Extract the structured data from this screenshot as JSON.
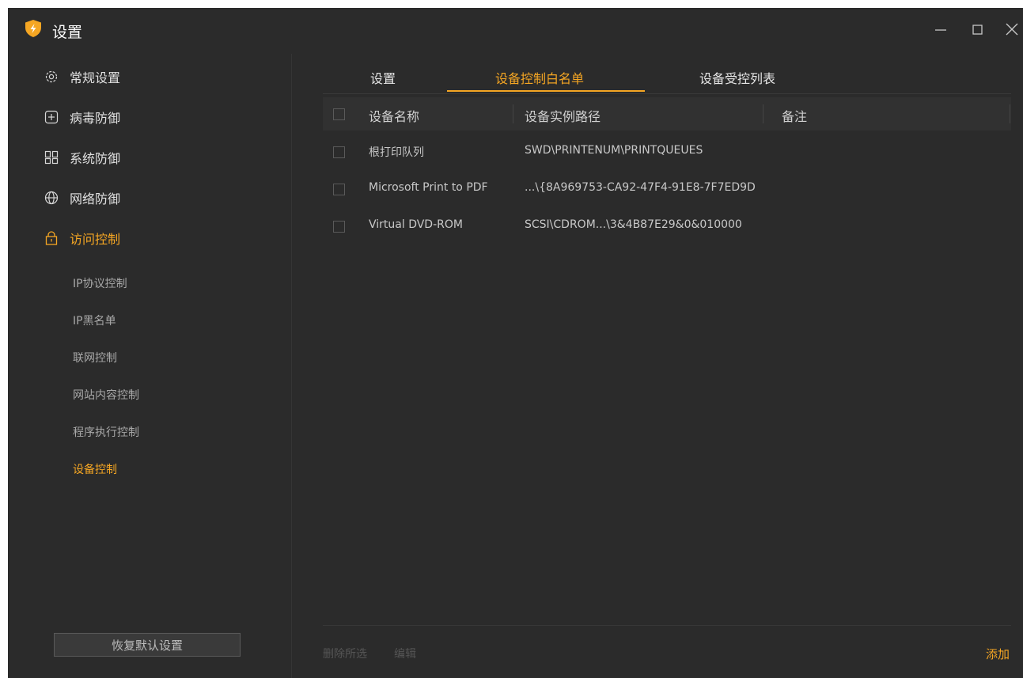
{
  "window": {
    "title": "设置",
    "controls": {
      "minimize": "minimize-icon",
      "maximize": "maximize-icon",
      "close": "close-icon"
    }
  },
  "sidebar": {
    "items": [
      {
        "label": "常规设置",
        "icon": "gear-icon"
      },
      {
        "label": "病毒防御",
        "icon": "plus-box-icon"
      },
      {
        "label": "系统防御",
        "icon": "grid-icon"
      },
      {
        "label": "网络防御",
        "icon": "globe-icon"
      },
      {
        "label": "访问控制",
        "icon": "lock-icon",
        "active": true
      }
    ],
    "subitems": [
      {
        "label": "IP协议控制"
      },
      {
        "label": "IP黑名单"
      },
      {
        "label": "联网控制"
      },
      {
        "label": "网站内容控制"
      },
      {
        "label": "程序执行控制"
      },
      {
        "label": "设备控制",
        "active": true
      }
    ],
    "reset_label": "恢复默认设置"
  },
  "tabs": [
    {
      "label": "设置"
    },
    {
      "label": "设备控制白名单",
      "active": true
    },
    {
      "label": "设备受控列表"
    }
  ],
  "table": {
    "headers": [
      "设备名称",
      "设备实例路径",
      "备注"
    ],
    "rows": [
      {
        "name": "根打印队列",
        "path": "SWD\\PRINTENUM\\PRINTQUEUES",
        "note": ""
      },
      {
        "name": "Microsoft Print to PDF",
        "path": "...\\{8A969753-CA92-47F4-91E8-7F7ED9D",
        "note": ""
      },
      {
        "name": "Virtual DVD-ROM",
        "path": "SCSI\\CDROM...\\3&4B87E29&0&010000",
        "note": ""
      }
    ]
  },
  "footer": {
    "delete_selected": "删除所选",
    "edit": "编辑",
    "add": "添加"
  },
  "colors": {
    "accent": "#f5a623",
    "background": "#2b2b2b",
    "header_bg": "#313131"
  }
}
